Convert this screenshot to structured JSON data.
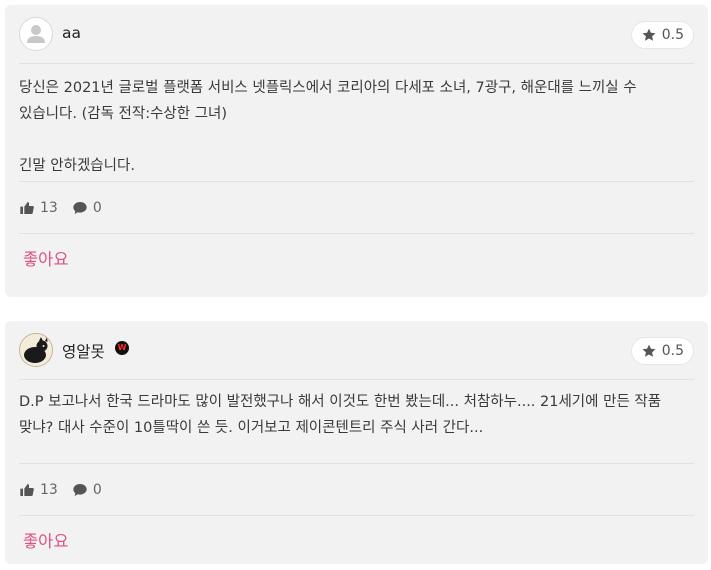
{
  "reviews": [
    {
      "username": "aa",
      "rating": "0.5",
      "has_badge": false,
      "text": "당신은 2021년 글로벌 플랫폼 서비스 넷플릭스에서 코리아의 다세포 소녀, 7광구, 해운대를 느끼실 수 있습니다. (감독 전작:수상한 그녀)\n\n긴말 안하겠습니다.",
      "likes": "13",
      "comments": "0",
      "like_label": "좋아요"
    },
    {
      "username": "영알못",
      "rating": "0.5",
      "has_badge": true,
      "text": "D.P 보고나서 한국 드라마도 많이 발전했구나 해서 이것도 한번 봤는데... 처참하누.... 21세기에 만든 작품 맞냐? 대사 수준이 10틀딱이 쓴 듯. 이거보고 제이콘텐트리 주식 사러 간다...",
      "likes": "13",
      "comments": "0",
      "like_label": "좋아요"
    }
  ],
  "icons": {
    "star": "star-icon",
    "thumbs_up": "thumbs-up-icon",
    "comment": "comment-icon",
    "default_avatar": "user-icon"
  },
  "colors": {
    "card_background": "#f2f2f2",
    "like_button": "#e05180",
    "badge_background": "#111111",
    "badge_mark": "#ff2a2a"
  }
}
